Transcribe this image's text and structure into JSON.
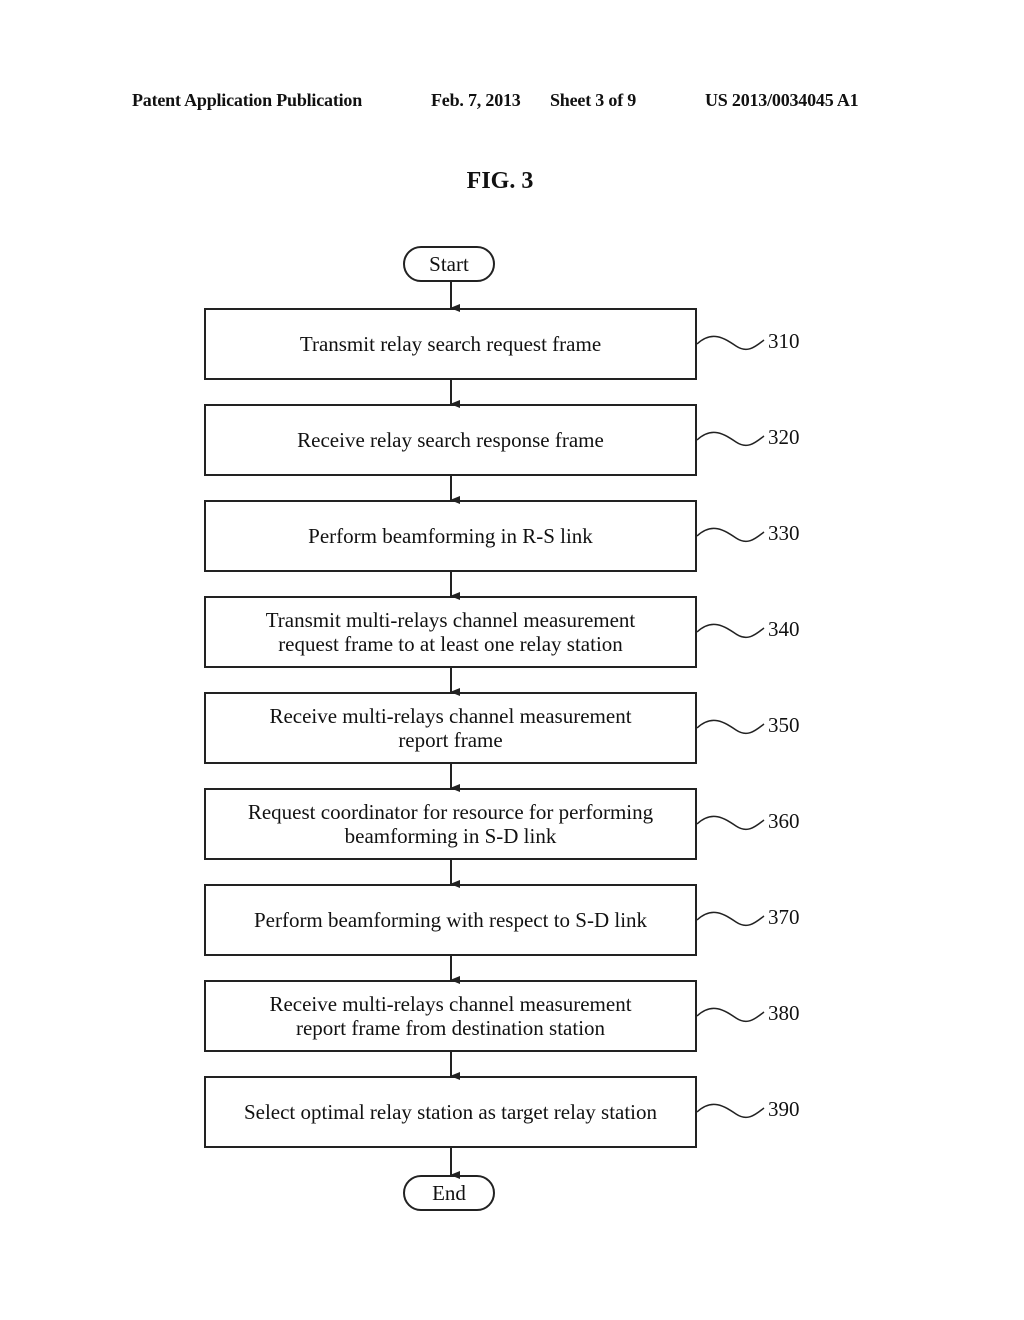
{
  "header": {
    "publication": "Patent Application Publication",
    "date": "Feb. 7, 2013",
    "sheet": "Sheet 3 of 9",
    "number": "US 2013/0034045 A1"
  },
  "figure": {
    "title": "FIG. 3",
    "start_label": "Start",
    "end_label": "End",
    "steps": [
      {
        "ref": "310",
        "lines": [
          "Transmit relay search request frame"
        ]
      },
      {
        "ref": "320",
        "lines": [
          "Receive relay search response frame"
        ]
      },
      {
        "ref": "330",
        "lines": [
          "Perform beamforming in R-S link"
        ]
      },
      {
        "ref": "340",
        "lines": [
          "Transmit multi-relays channel measurement",
          "request frame to at least one relay station"
        ]
      },
      {
        "ref": "350",
        "lines": [
          "Receive multi-relays channel measurement",
          "report frame"
        ]
      },
      {
        "ref": "360",
        "lines": [
          "Request coordinator for resource for performing",
          "beamforming in S-D link"
        ]
      },
      {
        "ref": "370",
        "lines": [
          "Perform beamforming with respect to S-D link"
        ]
      },
      {
        "ref": "380",
        "lines": [
          "Receive multi-relays channel measurement",
          "report frame from destination station"
        ]
      },
      {
        "ref": "390",
        "lines": [
          "Select optimal relay station as target relay station"
        ]
      }
    ]
  }
}
